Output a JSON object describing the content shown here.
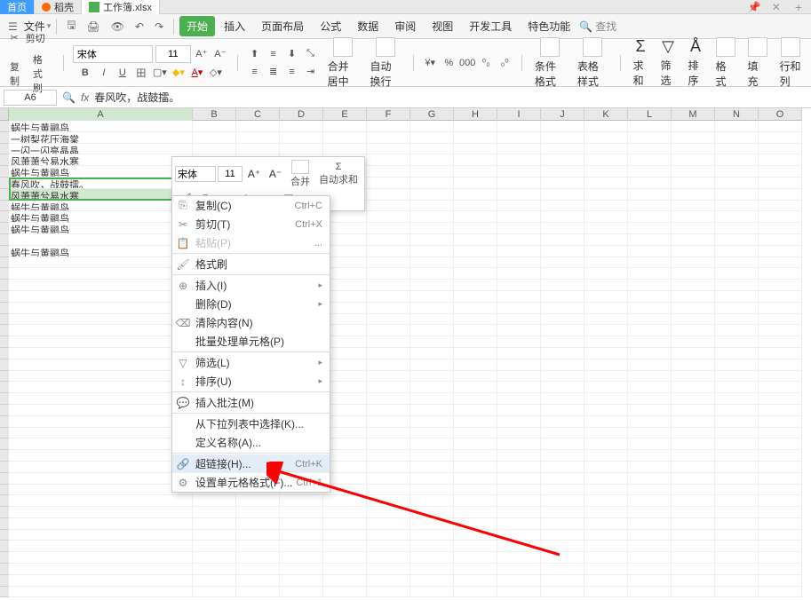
{
  "tabs": {
    "home": "首页",
    "doc1": "稻壳",
    "doc2": "工作簿.xlsx"
  },
  "menu": {
    "file": "文件",
    "start": "开始",
    "insert": "插入",
    "pageLayout": "页面布局",
    "formula": "公式",
    "data": "数据",
    "review": "审阅",
    "view": "视图",
    "devTools": "开发工具",
    "specialFn": "特色功能",
    "search": "查找"
  },
  "ribbon": {
    "cut": "剪切",
    "copy": "复制",
    "formatPainter": "格式刷",
    "fontName": "宋体",
    "fontSize": "11",
    "mergeCenter": "合并居中",
    "autoWrap": "自动换行",
    "condFormat": "条件格式",
    "tableStyle": "表格样式",
    "sum": "求和",
    "filter": "筛选",
    "sort": "排序",
    "format": "格式",
    "fill": "填充",
    "rowCol": "行和列"
  },
  "formulaBar": {
    "cellRef": "A6",
    "content": "春风吹，战鼓擂。"
  },
  "columns": [
    "A",
    "B",
    "C",
    "D",
    "E",
    "F",
    "G",
    "H",
    "I",
    "J",
    "K",
    "L",
    "M",
    "N",
    "O"
  ],
  "rowData": [
    "蜗牛与黄鹂鸟",
    "一树梨花压海棠",
    "一闪一闪亮晶晶",
    "风萧萧兮易水寒",
    "蜗牛与黄鹂鸟",
    "春风吹，战鼓擂。",
    "风萧萧兮易水寒",
    "蜗牛与黄鹂鸟",
    "蜗牛与黄鹂鸟",
    "蜗牛与黄鹂鸟",
    "",
    "蜗牛与黄鹂鸟"
  ],
  "miniToolbar": {
    "fontName": "宋体",
    "fontSize": "11",
    "merge": "合并",
    "autoSum": "自动求和"
  },
  "contextMenu": {
    "copy": {
      "label": "复制(C)",
      "shortcut": "Ctrl+C"
    },
    "cut": {
      "label": "剪切(T)",
      "shortcut": "Ctrl+X"
    },
    "paste": {
      "label": "粘贴(P)",
      "shortcut": "..."
    },
    "formatBrush": {
      "label": "格式刷"
    },
    "insert": {
      "label": "插入(I)"
    },
    "delete": {
      "label": "删除(D)"
    },
    "clearContent": {
      "label": "清除内容(N)"
    },
    "batchCells": {
      "label": "批量处理单元格(P)"
    },
    "filterL": {
      "label": "筛选(L)"
    },
    "sortU": {
      "label": "排序(U)"
    },
    "insertComment": {
      "label": "插入批注(M)"
    },
    "pickFromList": {
      "label": "从下拉列表中选择(K)..."
    },
    "defineName": {
      "label": "定义名称(A)..."
    },
    "hyperlink": {
      "label": "超链接(H)...",
      "shortcut": "Ctrl+K"
    },
    "cellFormat": {
      "label": "设置单元格格式(F)...",
      "shortcut": "Ctrl+1"
    }
  }
}
